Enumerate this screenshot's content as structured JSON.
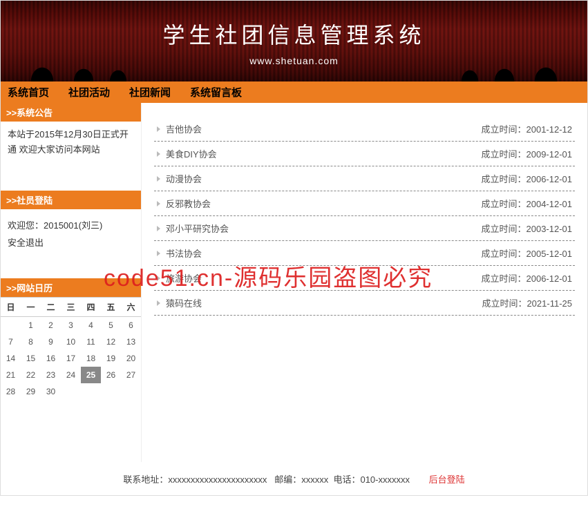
{
  "banner": {
    "title": "学生社团信息管理系统",
    "url": "www.shetuan.com"
  },
  "nav": {
    "items": [
      {
        "label": "系统首页"
      },
      {
        "label": "社团活动"
      },
      {
        "label": "社团新闻"
      },
      {
        "label": "系统留言板"
      }
    ]
  },
  "sidebar": {
    "announce": {
      "title": ">>系统公告",
      "text": "本站于2015年12月30日正式开通 欢迎大家访问本网站"
    },
    "login": {
      "title": ">>社员登陆",
      "welcome": "欢迎您：2015001(刘三)",
      "logout": "安全退出"
    },
    "calendar": {
      "title": ">>网站日历",
      "weekdays": [
        "日",
        "一",
        "二",
        "三",
        "四",
        "五",
        "六"
      ],
      "leading_blanks": 1,
      "days": 30,
      "today": 25
    }
  },
  "main": {
    "clubs": [
      {
        "name": "吉他协会",
        "date_label": "成立时间：",
        "date": "2001-12-12"
      },
      {
        "name": "美食DIY协会",
        "date_label": "成立时间：",
        "date": "2009-12-01"
      },
      {
        "name": "动漫协会",
        "date_label": "成立时间：",
        "date": "2006-12-01"
      },
      {
        "name": "反邪教协会",
        "date_label": "成立时间：",
        "date": "2004-12-01"
      },
      {
        "name": "邓小平研究协会",
        "date_label": "成立时间：",
        "date": "2003-12-01"
      },
      {
        "name": "书法协会",
        "date_label": "成立时间：",
        "date": "2005-12-01"
      },
      {
        "name": "旅游协会",
        "date_label": "成立时间：",
        "date": "2006-12-01"
      },
      {
        "name": "猿码在线",
        "date_label": "成立时间：",
        "date": "2021-11-25"
      }
    ]
  },
  "footer": {
    "contact_label": "联系地址：",
    "contact": "xxxxxxxxxxxxxxxxxxxxxx",
    "zip_label": "邮编：",
    "zip": "xxxxxx",
    "phone_label": "电话：",
    "phone": "010-xxxxxxx",
    "admin_login": "后台登陆"
  },
  "watermark": "code51.cn-源码乐园盗图必究"
}
